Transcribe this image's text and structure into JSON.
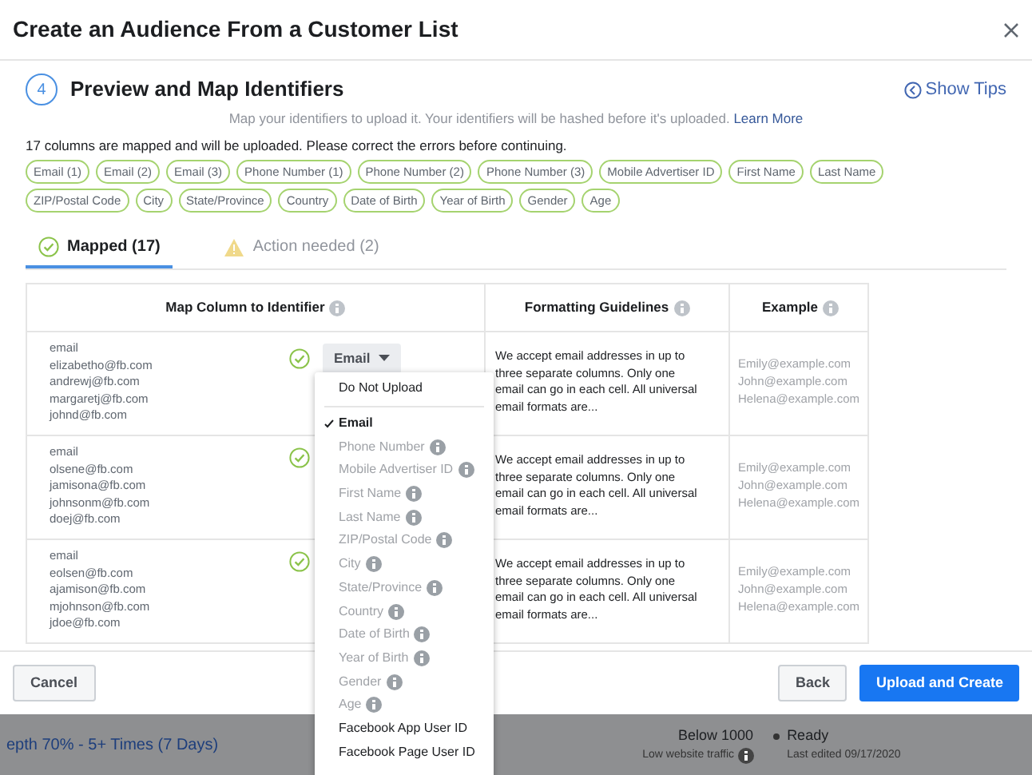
{
  "dialog": {
    "title": "Create an Audience From a Customer List"
  },
  "step": {
    "number": "4",
    "title": "Preview and Map Identifiers",
    "subtitle": "Map your identifiers to upload it. Your identifiers will be hashed before it's uploaded.",
    "link": "Learn More",
    "tips": "Show Tips"
  },
  "summary": "17 columns are mapped and will be uploaded. Please correct the errors before continuing.",
  "chips": [
    "Email (1)",
    "Email (2)",
    "Email (3)",
    "Phone Number (1)",
    "Phone Number (2)",
    "Phone Number (3)",
    "Mobile Advertiser ID",
    "First Name",
    "Last Name",
    "ZIP/Postal Code",
    "City",
    "State/Province",
    "Country",
    "Date of Birth",
    "Year of Birth",
    "Gender",
    "Age"
  ],
  "tabs": [
    {
      "label": "Mapped (17)",
      "kind": "check",
      "selected": true
    },
    {
      "label": "Action needed (2)",
      "kind": "warning",
      "selected": false
    }
  ],
  "table": {
    "columns": [
      "Map Column to Identifier",
      "Formatting Guidelines",
      "Example"
    ],
    "rows": [
      {
        "values": [
          "email",
          "elizabetho@fb.com",
          "andrewj@fb.com",
          "margaretj@fb.com",
          "johnd@fb.com"
        ],
        "identifier": "Email",
        "guideline": "We accept email addresses in up to three separate columns. Only one email can go in each cell. All universal email formats are...",
        "examples": [
          "Emily@example.com",
          "John@example.com",
          "Helena@example.com"
        ]
      },
      {
        "values": [
          "email",
          "olsene@fb.com",
          "jamisona@fb.com",
          "johnsonm@fb.com",
          "doej@fb.com"
        ],
        "guideline": "We accept email addresses in up to three separate columns. Only one email can go in each cell. All universal email formats are...",
        "examples": [
          "Emily@example.com",
          "John@example.com",
          "Helena@example.com"
        ]
      },
      {
        "values": [
          "email",
          "eolsen@fb.com",
          "ajamison@fb.com",
          "mjohnson@fb.com",
          "jdoe@fb.com"
        ],
        "guideline": "We accept email addresses in up to three separate columns. Only one email can go in each cell. All universal email formats are...",
        "examples": [
          "Emily@example.com",
          "John@example.com",
          "Helena@example.com"
        ]
      }
    ]
  },
  "dropdown": {
    "items": [
      {
        "label": "Do Not Upload",
        "selected": false,
        "disabled": false,
        "info": false
      },
      {
        "label": "Email",
        "selected": true,
        "disabled": false,
        "info": false
      },
      {
        "label": "Phone Number",
        "selected": false,
        "disabled": true,
        "info": true
      },
      {
        "label": "Mobile Advertiser ID",
        "selected": false,
        "disabled": true,
        "info": true
      },
      {
        "label": "First Name",
        "selected": false,
        "disabled": true,
        "info": true
      },
      {
        "label": "Last Name",
        "selected": false,
        "disabled": true,
        "info": true
      },
      {
        "label": "ZIP/Postal Code",
        "selected": false,
        "disabled": true,
        "info": true
      },
      {
        "label": "City",
        "selected": false,
        "disabled": true,
        "info": true
      },
      {
        "label": "State/Province",
        "selected": false,
        "disabled": true,
        "info": true
      },
      {
        "label": "Country",
        "selected": false,
        "disabled": true,
        "info": true
      },
      {
        "label": "Date of Birth",
        "selected": false,
        "disabled": true,
        "info": true
      },
      {
        "label": "Year of Birth",
        "selected": false,
        "disabled": true,
        "info": true
      },
      {
        "label": "Gender",
        "selected": false,
        "disabled": true,
        "info": true
      },
      {
        "label": "Age",
        "selected": false,
        "disabled": true,
        "info": true
      },
      {
        "label": "Facebook App User ID",
        "selected": false,
        "disabled": false,
        "info": false
      },
      {
        "label": "Facebook Page User ID",
        "selected": false,
        "disabled": false,
        "info": false
      }
    ]
  },
  "buttons": {
    "cancel": "Cancel",
    "back": "Back",
    "primary": "Upload and Create"
  },
  "background": {
    "audience": "epth 70% - 5+ Times (7 Days)",
    "size": "Below 1000",
    "size_note": "Low website traffic",
    "status": "Ready",
    "edited": "Last edited 09/17/2020"
  }
}
